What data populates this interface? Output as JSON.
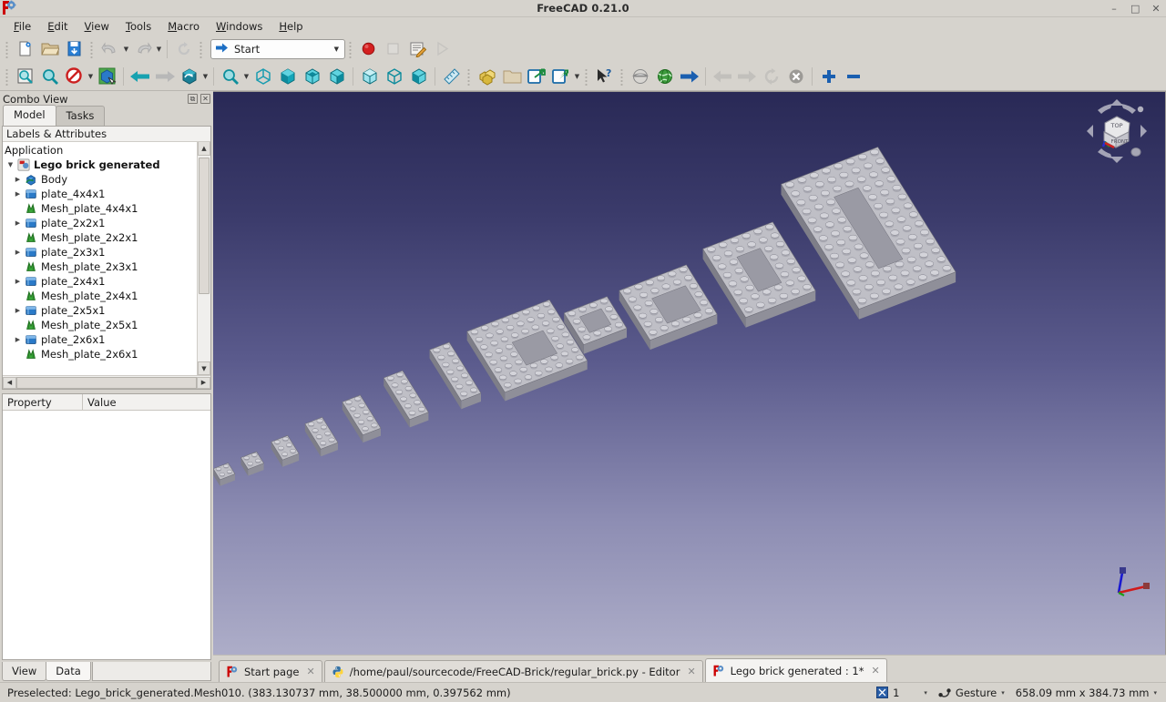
{
  "window": {
    "title": "FreeCAD 0.21.0",
    "app_icon": "freecad-logo-icon",
    "minimize": "–",
    "maximize": "□",
    "close": "✕"
  },
  "menubar": {
    "items": [
      {
        "label": "File",
        "mnemonic": "F"
      },
      {
        "label": "Edit",
        "mnemonic": "E"
      },
      {
        "label": "View",
        "mnemonic": "V"
      },
      {
        "label": "Tools",
        "mnemonic": "T"
      },
      {
        "label": "Macro",
        "mnemonic": "M"
      },
      {
        "label": "Windows",
        "mnemonic": "W"
      },
      {
        "label": "Help",
        "mnemonic": "H"
      }
    ]
  },
  "toolbar_file": {
    "buttons": [
      {
        "name": "new-document-icon",
        "tip": "New"
      },
      {
        "name": "open-document-icon",
        "tip": "Open"
      },
      {
        "name": "save-document-icon",
        "tip": "Save"
      },
      {
        "name": "undo-icon",
        "tip": "Undo"
      },
      {
        "name": "redo-icon",
        "tip": "Redo"
      },
      {
        "name": "refresh-icon",
        "tip": "Refresh"
      }
    ]
  },
  "workbench": {
    "selected": "Start",
    "icon": "start-arrow-icon",
    "chevron": "▼"
  },
  "toolbar_macro": {
    "buttons": [
      {
        "name": "macro-record-icon",
        "tip": "Macro recording"
      },
      {
        "name": "macro-stop-icon",
        "tip": "Stop macro recording"
      },
      {
        "name": "macro-edit-icon",
        "tip": "Macros"
      },
      {
        "name": "macro-execute-icon",
        "tip": "Execute macro"
      }
    ]
  },
  "toolbar_view": {
    "buttons": [
      {
        "name": "fit-all-icon",
        "tip": "Fit all"
      },
      {
        "name": "fit-selection-icon",
        "tip": "Fit selection"
      },
      {
        "name": "draw-style-icon",
        "tip": "Draw style"
      },
      {
        "name": "isometric-view-icon",
        "tip": "Axonometric"
      },
      {
        "name": "back-view-nav-icon",
        "tip": "Back"
      },
      {
        "name": "forward-view-nav-icon",
        "tip": "Forward"
      },
      {
        "name": "axonometric-icon",
        "tip": "Axonometric"
      },
      {
        "name": "zoom-box-icon",
        "tip": "Zoom box"
      },
      {
        "name": "isometric-cube-icon",
        "tip": "Isometric"
      },
      {
        "name": "front-view-icon",
        "tip": "Front"
      },
      {
        "name": "top-view-icon",
        "tip": "Top"
      },
      {
        "name": "right-view-icon",
        "tip": "Right"
      },
      {
        "name": "rear-view-icon",
        "tip": "Rear"
      },
      {
        "name": "bottom-view-icon",
        "tip": "Bottom"
      },
      {
        "name": "left-view-icon",
        "tip": "Left"
      },
      {
        "name": "measure-icon",
        "tip": "Measure"
      }
    ]
  },
  "toolbar_structure": {
    "buttons": [
      {
        "name": "create-part-icon",
        "tip": "Create part"
      },
      {
        "name": "create-group-icon",
        "tip": "Create group"
      },
      {
        "name": "link-make-icon",
        "tip": "Make link"
      },
      {
        "name": "link-group-icon",
        "tip": "Make sub-link"
      },
      {
        "name": "whats-this-icon",
        "tip": "What's this?"
      },
      {
        "name": "workbench-globe-gray-icon",
        "tip": "Navigation"
      },
      {
        "name": "web-browser-icon",
        "tip": "Web"
      },
      {
        "name": "web-forward-blue-icon",
        "tip": "Go"
      },
      {
        "name": "web-back-icon",
        "tip": "Previous"
      },
      {
        "name": "web-next-icon",
        "tip": "Next"
      },
      {
        "name": "web-refresh-icon",
        "tip": "Refresh web page"
      },
      {
        "name": "web-stop-icon",
        "tip": "Stop loading"
      },
      {
        "name": "zoom-in-icon",
        "tip": "Zoom in"
      },
      {
        "name": "zoom-out-icon",
        "tip": "Zoom out"
      }
    ]
  },
  "combo_view": {
    "title": "Combo View",
    "float_button": "⧉",
    "close_button": "✕",
    "tabs": [
      {
        "label": "Model",
        "active": true
      },
      {
        "label": "Tasks",
        "active": false
      }
    ],
    "tree_header": "Labels & Attributes",
    "tree": [
      {
        "label": "Application",
        "indent": 0,
        "expander": "",
        "icon": "",
        "bold": false
      },
      {
        "label": "Lego brick generated",
        "indent": 0,
        "expander": "▼",
        "icon": "document-icon",
        "bold": true
      },
      {
        "label": "Body",
        "indent": 1,
        "expander": "▶",
        "icon": "body-icon",
        "bold": false
      },
      {
        "label": "plate_4x4x1",
        "indent": 1,
        "expander": "▶",
        "icon": "part-box-icon",
        "bold": false
      },
      {
        "label": "Mesh_plate_4x4x1",
        "indent": 1,
        "expander": "",
        "icon": "mesh-icon",
        "bold": false
      },
      {
        "label": "plate_2x2x1",
        "indent": 1,
        "expander": "▶",
        "icon": "part-box-icon",
        "bold": false
      },
      {
        "label": "Mesh_plate_2x2x1",
        "indent": 1,
        "expander": "",
        "icon": "mesh-icon",
        "bold": false
      },
      {
        "label": "plate_2x3x1",
        "indent": 1,
        "expander": "▶",
        "icon": "part-box-icon",
        "bold": false
      },
      {
        "label": "Mesh_plate_2x3x1",
        "indent": 1,
        "expander": "",
        "icon": "mesh-icon",
        "bold": false
      },
      {
        "label": "plate_2x4x1",
        "indent": 1,
        "expander": "▶",
        "icon": "part-box-icon",
        "bold": false
      },
      {
        "label": "Mesh_plate_2x4x1",
        "indent": 1,
        "expander": "",
        "icon": "mesh-icon",
        "bold": false
      },
      {
        "label": "plate_2x5x1",
        "indent": 1,
        "expander": "▶",
        "icon": "part-box-icon",
        "bold": false
      },
      {
        "label": "Mesh_plate_2x5x1",
        "indent": 1,
        "expander": "",
        "icon": "mesh-icon",
        "bold": false
      },
      {
        "label": "plate_2x6x1",
        "indent": 1,
        "expander": "▶",
        "icon": "part-box-icon",
        "bold": false
      },
      {
        "label": "Mesh_plate_2x6x1",
        "indent": 1,
        "expander": "",
        "icon": "mesh-icon",
        "bold": false
      }
    ],
    "property_header": {
      "property": "Property",
      "value": "Value"
    },
    "bottom_tabs": [
      {
        "label": "View",
        "active": false
      },
      {
        "label": "Data",
        "active": true
      }
    ]
  },
  "view3d": {
    "navcube": {
      "top_face": "TOP",
      "front_face": "FRONT"
    },
    "background_top": "#292956",
    "background_bottom": "#adadc8",
    "model_color": "#c6c6c6",
    "axis": {
      "x": "x",
      "y": "y",
      "z": "z"
    }
  },
  "document_tabs": [
    {
      "label": "Start page",
      "icon": "freecad-logo-icon",
      "close": "✕",
      "active": false
    },
    {
      "label": "/home/paul/sourcecode/FreeCAD-Brick/regular_brick.py - Editor",
      "icon": "python-icon",
      "close": "✕",
      "active": false
    },
    {
      "label": "Lego brick generated : 1*",
      "icon": "freecad-logo-icon",
      "close": "✕",
      "active": true
    }
  ],
  "statusbar": {
    "message": "Preselected: Lego_brick_generated.Mesh010. (383.130737 mm, 38.500000 mm, 0.397562 mm)",
    "dimension_indicator": "1",
    "dimension_chevron": "▾",
    "navigation_style": "Gesture",
    "navigation_chevron": "▾",
    "navigation_icon": "gesture-icon",
    "view_size": "658.09 mm x 384.73 mm",
    "view_size_chevron": "▾"
  }
}
